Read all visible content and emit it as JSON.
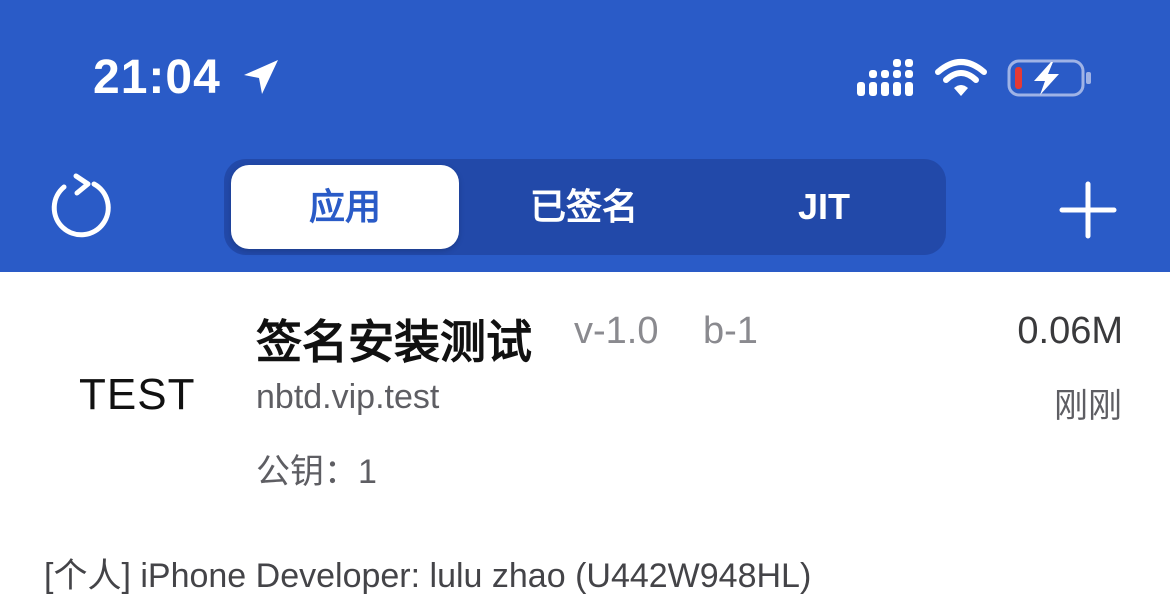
{
  "status_bar": {
    "time": "21:04",
    "icons": [
      "location-arrow-icon",
      "cellular-signal-icon",
      "wifi-icon",
      "battery-charging-icon"
    ],
    "battery_level_color": "#e53935"
  },
  "toolbar": {
    "refresh_icon": "refresh-icon",
    "add_icon": "plus-icon",
    "tabs": [
      {
        "label": "应用",
        "active": true
      },
      {
        "label": "已签名",
        "active": false
      },
      {
        "label": "JIT",
        "active": false
      }
    ]
  },
  "app": {
    "icon_text": "TEST",
    "name": "签名安装测试",
    "version": "v-1.0",
    "build": "b-1",
    "size": "0.06M",
    "bundle_id": "nbtd.vip.test",
    "time": "刚刚",
    "public_key": "公钥：1"
  },
  "certificate": {
    "line": "[个人] iPhone Developer: lulu zhao (U442W948HL)"
  },
  "colors": {
    "header_bg": "#2a5bc7",
    "segment_bg": "#2249a9",
    "active_tab_text": "#2a5bc7"
  }
}
